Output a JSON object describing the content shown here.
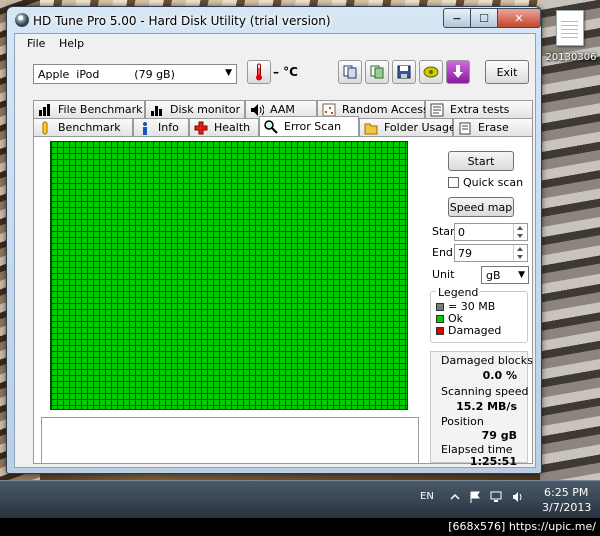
{
  "desktop": {
    "file_label": "20130306"
  },
  "window": {
    "title": "HD Tune Pro 5.00 - Hard Disk Utility (trial version)",
    "controls": {
      "minimize": "−",
      "maximize": "☐",
      "close": "✕"
    }
  },
  "menu": {
    "file": "File",
    "help": "Help"
  },
  "toolbar": {
    "drive": "Apple  iPod          (79 gB)",
    "temperature": "– °C",
    "exit": "Exit"
  },
  "tabs_row1": [
    "File Benchmark",
    "Disk monitor",
    "AAM",
    "Random Access",
    "Extra tests"
  ],
  "tabs_row2": [
    "Benchmark",
    "Info",
    "Health",
    "Error Scan",
    "Folder Usage",
    "Erase"
  ],
  "active_tab": "Error Scan",
  "scan": {
    "start_button": "Start",
    "quick_scan_label": "Quick scan",
    "quick_scan_checked": false,
    "speed_map_button": "Speed map",
    "start_label": "Start",
    "start_value": "0",
    "end_label": "End",
    "end_value": "79",
    "unit_label": "Unit",
    "unit_value": "gB"
  },
  "legend": {
    "title": "Legend",
    "items": [
      {
        "label": "= 30 MB",
        "color": "#7a7a7a"
      },
      {
        "label": "Ok",
        "color": "#00cc00"
      },
      {
        "label": "Damaged",
        "color": "#dd0000"
      }
    ]
  },
  "stats": {
    "damaged_label": "Damaged blocks",
    "damaged_value": "0.0 %",
    "speed_label": "Scanning speed",
    "speed_value": "15.2 MB/s",
    "position_label": "Position",
    "position_value": "79 gB",
    "elapsed_label": "Elapsed time",
    "elapsed_value": "1:25:51"
  },
  "taskbar": {
    "language": "EN",
    "time": "6:25 PM",
    "date": "3/7/2013"
  },
  "watermark": "[668x576] https://upic.me/"
}
